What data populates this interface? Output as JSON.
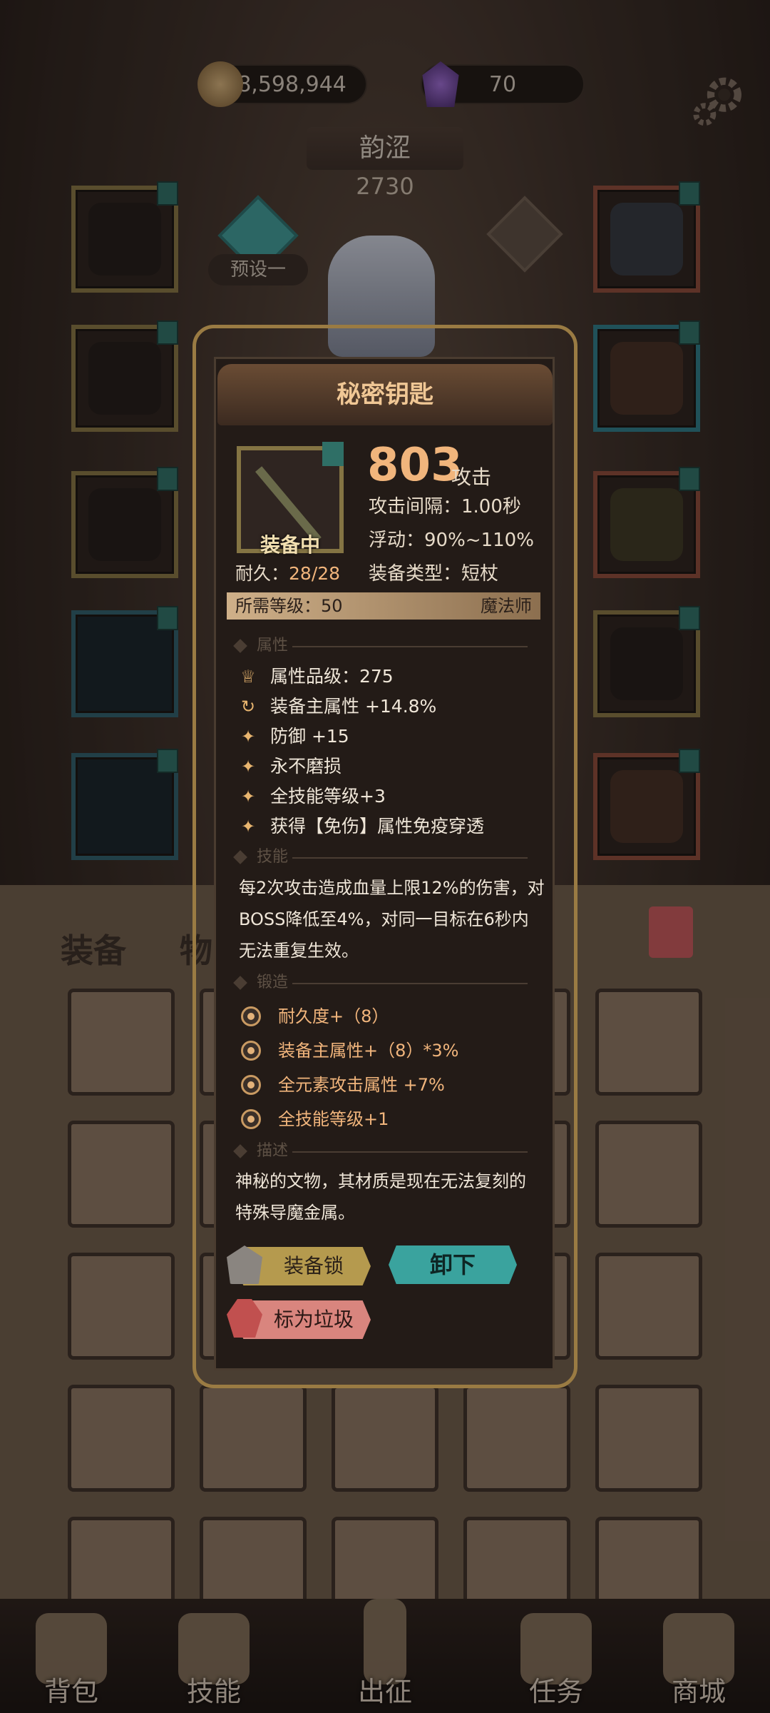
{
  "currency": {
    "gold": "98,598,944",
    "gems": "70"
  },
  "character": {
    "name": "韵涩",
    "power": "2730",
    "preset_label": "预设一"
  },
  "tabs": {
    "equipment": "装备",
    "items": "物"
  },
  "item": {
    "title": "秘密钥匙",
    "status": "装备中",
    "attack_value": "803",
    "attack_unit": "攻击",
    "attack_interval": "攻击间隔：1.00秒",
    "float_range": "浮动：90%~110%",
    "equip_type": "装备类型：短杖",
    "durability_label": "耐久：",
    "durability_value": "28/28",
    "required_level": "所需等级：50",
    "class": "魔法师",
    "sections": {
      "attributes": "属性",
      "skill": "技能",
      "forge": "锻造",
      "description": "描述"
    },
    "attributes": [
      "属性品级：275",
      "装备主属性 +14.8%",
      "防御 +15",
      "永不磨损",
      "全技能等级+3",
      "获得【免伤】属性免疫穿透"
    ],
    "skill_text": "每2次攻击造成血量上限12%的伤害，对BOSS降低至4%，对同一目标在6秒内无法重复生效。",
    "forge": [
      "耐久度+（8）",
      "装备主属性+（8）*3%",
      "全元素攻击属性 +7%",
      "全技能等级+1"
    ],
    "description": "神秘的文物，其材质是现在无法复刻的特殊导魔金属。",
    "buttons": {
      "lock": "装备锁",
      "unequip": "卸下",
      "trash": "标为垃圾"
    }
  },
  "nav": [
    {
      "label": "背包",
      "icon": "backpack-icon"
    },
    {
      "label": "技能",
      "icon": "skill-book-icon"
    },
    {
      "label": "出征",
      "icon": "sword-icon"
    },
    {
      "label": "任务",
      "icon": "quest-horn-icon"
    },
    {
      "label": "商城",
      "icon": "shop-icon"
    }
  ],
  "colors": {
    "accent_gold": "#f1b57c",
    "unequip_teal": "#3aa39e",
    "trash_red": "#d9857e",
    "lock_yellow": "#b59a4e"
  }
}
